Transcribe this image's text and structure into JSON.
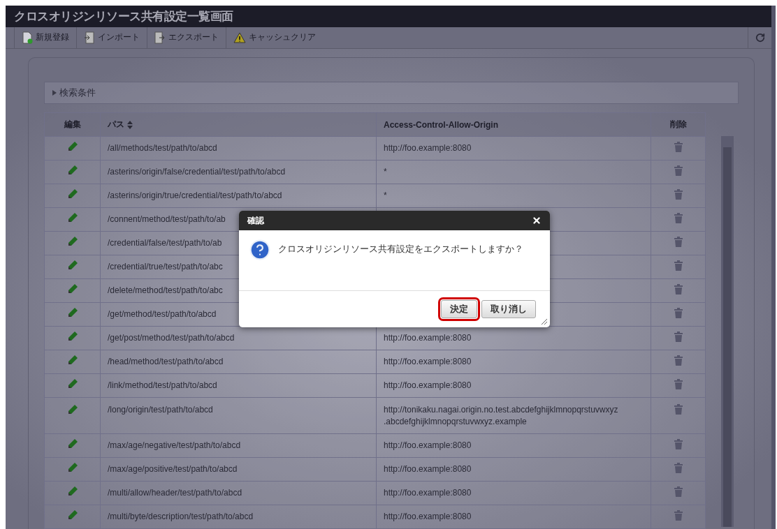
{
  "window": {
    "title": "クロスオリジンリソース共有設定一覧画面"
  },
  "toolbar": [
    {
      "label": "新規登録"
    },
    {
      "label": "インポート"
    },
    {
      "label": "エクスポート"
    },
    {
      "label": "キャッシュクリア"
    }
  ],
  "search_conditions": {
    "label": "検索条件",
    "expanded": false
  },
  "table": {
    "columns": [
      {
        "label": "編集",
        "sortable": false
      },
      {
        "label": "パス",
        "sortable": true
      },
      {
        "label": "Access-Control-Allow-Origin",
        "sortable": false
      },
      {
        "label": "削除",
        "sortable": false
      }
    ],
    "rows": [
      {
        "path": "/all/methods/test/path/to/abcd",
        "origin": "http://foo.example:8080"
      },
      {
        "path": "/asterins/origin/false/credential/test/path/to/abcd",
        "origin": "*"
      },
      {
        "path": "/asterins/origin/true/credential/test/path/to/abcd",
        "origin": "*"
      },
      {
        "path": "/connent/method/test/path/to/ab"
      },
      {
        "path": "/credential/false/test/path/to/ab"
      },
      {
        "path": "/credential/true/test/path/to/abc"
      },
      {
        "path": "/delete/method/test/path/to/abc"
      },
      {
        "path": "/get/method/test/path/to/abcd"
      },
      {
        "path": "/get/post/method/test/path/to/abcd",
        "origin": "http://foo.example:8080"
      },
      {
        "path": "/head/method/test/path/to/abcd",
        "origin": "http://foo.example:8080"
      },
      {
        "path": "/link/method/test/path/to/abcd",
        "origin": "http://foo.example:8080"
      },
      {
        "path": "/long/origin/test/path/to/abcd",
        "origin": "http://tonikaku.nagai.origin.no.test.abcdefghijklmnopqrstuvwxyz .abcdefghijklmnopqrstuvwxyz.example"
      },
      {
        "path": "/max/age/negative/test/path/to/abcd",
        "origin": "http://foo.example:8080"
      },
      {
        "path": "/max/age/positive/test/path/to/abcd",
        "origin": "http://foo.example:8080"
      },
      {
        "path": "/multi/allow/header/test/path/to/abcd",
        "origin": "http://foo.example:8080"
      },
      {
        "path": "/multi/byte/description/test/path/to/abcd",
        "origin": "http://foo.example:8080"
      }
    ]
  },
  "dialog": {
    "title": "確認",
    "message": "クロスオリジンリソース共有設定をエクスポートしますか？",
    "buttons": [
      {
        "label": "決定",
        "focused": true
      },
      {
        "label": "取り消し",
        "focused": false
      }
    ]
  }
}
